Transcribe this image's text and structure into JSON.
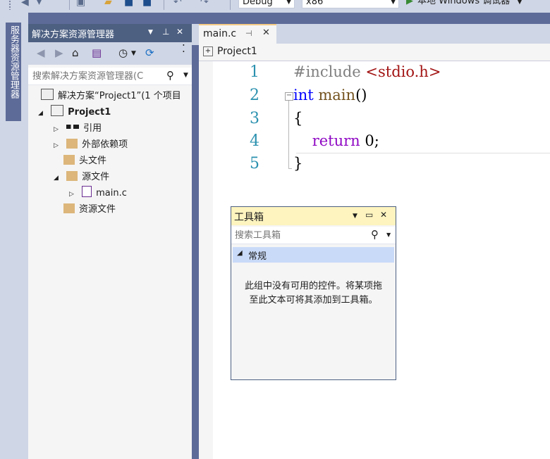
{
  "toolbar": {
    "config": "Debug",
    "platform": "x86",
    "run_label": "本地 Windows 调试器"
  },
  "side_strip": {
    "server_explorer_label": "服务器资源管理器"
  },
  "solution_explorer": {
    "title": "解决方案资源管理器",
    "search_placeholder": "搜索解决方案资源管理器(C",
    "tree": [
      {
        "label": "解决方案“Project1”(1 个项目"
      },
      {
        "label": "Project1"
      },
      {
        "label": "引用"
      },
      {
        "label": "外部依赖项"
      },
      {
        "label": "头文件"
      },
      {
        "label": "源文件"
      },
      {
        "label": "main.c"
      },
      {
        "label": "资源文件"
      }
    ]
  },
  "editor": {
    "tab_label": "main.c",
    "nav_scope": "Project1",
    "lines": [
      {
        "num": "1",
        "parts": [
          {
            "t": "#include ",
            "c": "pp"
          },
          {
            "t": "<stdio.h>",
            "c": "str"
          }
        ]
      },
      {
        "num": "2",
        "parts": [
          {
            "t": "int",
            "c": "kw"
          },
          {
            "t": " ",
            "c": ""
          },
          {
            "t": "main",
            "c": "fn"
          },
          {
            "t": "()",
            "c": ""
          }
        ]
      },
      {
        "num": "3",
        "parts": [
          {
            "t": "{",
            "c": ""
          }
        ]
      },
      {
        "num": "4",
        "parts": [
          {
            "t": "    ",
            "c": ""
          },
          {
            "t": "return",
            "c": "ret"
          },
          {
            "t": " 0;",
            "c": ""
          }
        ]
      },
      {
        "num": "5",
        "parts": [
          {
            "t": "}",
            "c": ""
          }
        ]
      }
    ]
  },
  "toolbox": {
    "title": "工具箱",
    "search_placeholder": "搜索工具箱",
    "group_label": "常规",
    "empty_message": "此组中没有可用的控件。将某项拖至此文本可将其添加到工具箱。"
  },
  "colors": {
    "frame": "#5d6b99",
    "toolwindow_title": "#4d6082",
    "toolbox_title": "#fdf4bf",
    "toolbox_group": "#c9daf8",
    "keyword": "#0000ff",
    "string": "#a31515",
    "control_keyword": "#8f08c4",
    "line_number": "#2b91af"
  }
}
